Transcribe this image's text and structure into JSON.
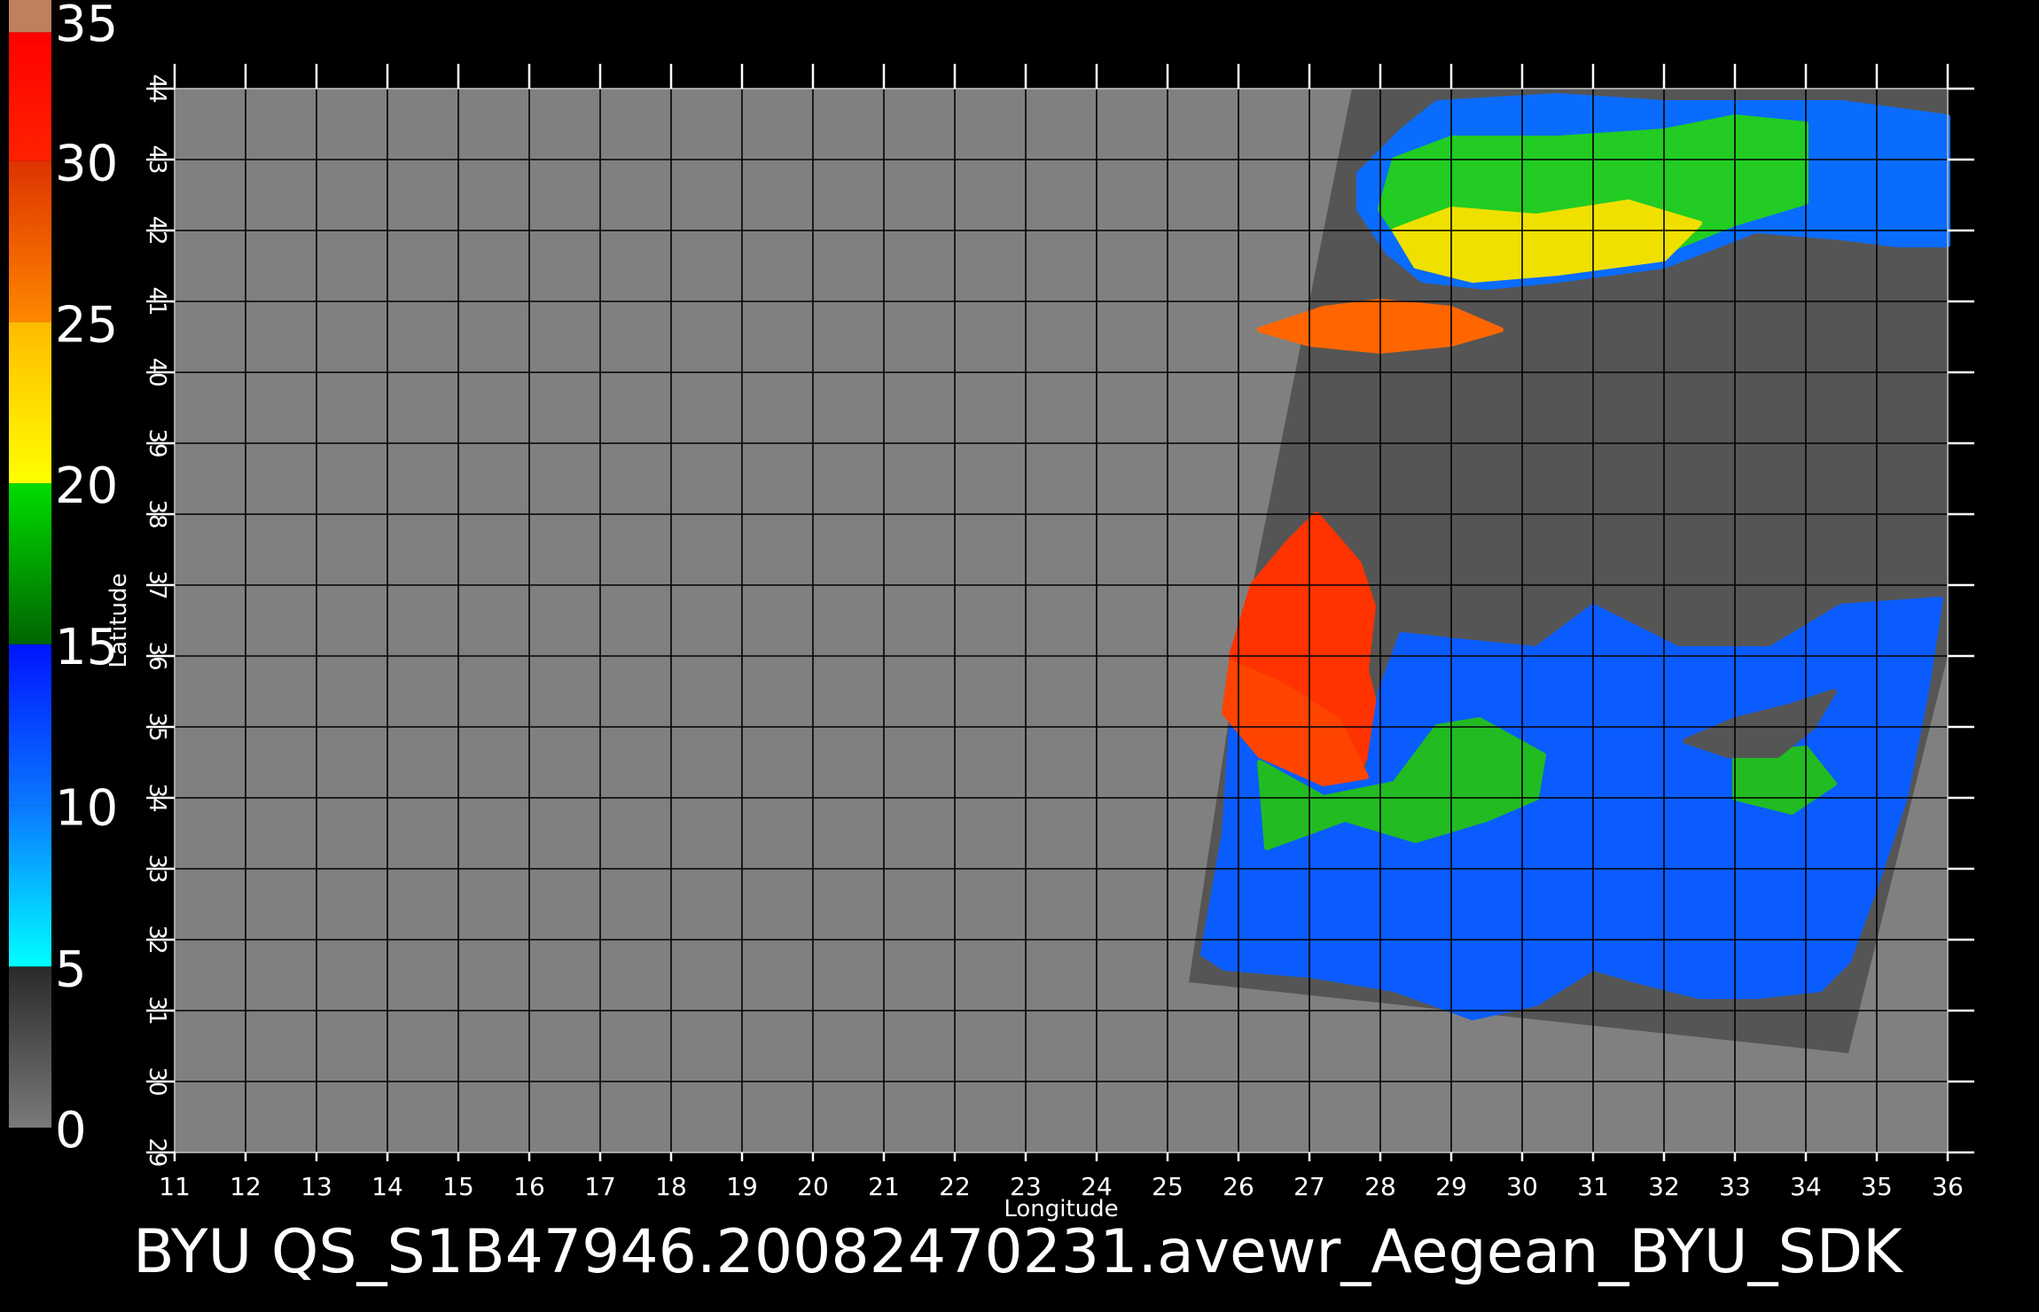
{
  "colorbar": {
    "tick_labels": [
      "0",
      "5",
      "10",
      "15",
      "20",
      "25",
      "30",
      "35"
    ],
    "segments": [
      {
        "from": 0,
        "to": 5,
        "color_bottom": "#7a7a7a",
        "color_top": "#2a2a2a"
      },
      {
        "from": 5,
        "to": 10,
        "color_bottom": "#00ffff",
        "color_top": "#0a78ff"
      },
      {
        "from": 10,
        "to": 15,
        "color_bottom": "#0a78ff",
        "color_top": "#0014ff"
      },
      {
        "from": 15,
        "to": 20,
        "color_bottom": "#006400",
        "color_top": "#00dd00"
      },
      {
        "from": 20,
        "to": 25,
        "color_bottom": "#ffff00",
        "color_top": "#ffbb00"
      },
      {
        "from": 25,
        "to": 30,
        "color_bottom": "#ff8800",
        "color_top": "#dd3300"
      },
      {
        "from": 30,
        "to": 34,
        "color_bottom": "#ff2200",
        "color_top": "#ff0000"
      },
      {
        "from": 34,
        "to": 35,
        "color_bottom": "#c08060",
        "color_top": "#c08060"
      }
    ]
  },
  "map": {
    "lon_range": [
      11,
      36
    ],
    "lat_range": [
      29,
      44
    ],
    "lon_ticks": [
      "11",
      "12",
      "13",
      "14",
      "15",
      "16",
      "17",
      "18",
      "19",
      "20",
      "21",
      "22",
      "23",
      "24",
      "25",
      "26",
      "27",
      "28",
      "29",
      "30",
      "31",
      "32",
      "33",
      "34",
      "35",
      "36"
    ],
    "lat_ticks": [
      "29",
      "30",
      "31",
      "32",
      "33",
      "34",
      "35",
      "36",
      "37",
      "38",
      "39",
      "40",
      "41",
      "42",
      "43",
      "44"
    ],
    "xlabel": "Longitude",
    "ylabel": "Latitude",
    "grid": true,
    "background_color": "#808080",
    "swath_color": "#555555",
    "swath_corners_lonlat": [
      [
        27.6,
        44.0
      ],
      [
        36.0,
        44.0
      ],
      [
        36.0,
        36.0
      ],
      [
        34.6,
        30.4
      ],
      [
        25.3,
        31.4
      ],
      [
        26.0,
        36.0
      ]
    ],
    "regions": [
      {
        "name": "black-sea-wind",
        "color": "#0a6cff",
        "polygon": [
          [
            27.7,
            42.8
          ],
          [
            28.3,
            43.4
          ],
          [
            28.8,
            43.8
          ],
          [
            30.5,
            43.9
          ],
          [
            32.0,
            43.8
          ],
          [
            34.5,
            43.8
          ],
          [
            36.0,
            43.6
          ],
          [
            36.0,
            41.8
          ],
          [
            35.3,
            41.8
          ],
          [
            34.5,
            41.9
          ],
          [
            33.3,
            42.0
          ],
          [
            32.0,
            41.5
          ],
          [
            30.5,
            41.3
          ],
          [
            29.5,
            41.2
          ],
          [
            28.6,
            41.3
          ],
          [
            28.1,
            41.7
          ],
          [
            27.7,
            42.3
          ]
        ]
      },
      {
        "name": "black-sea-moderate",
        "color": "#22cc22",
        "polygon": [
          [
            28.2,
            43.0
          ],
          [
            29.0,
            43.3
          ],
          [
            30.5,
            43.3
          ],
          [
            32.0,
            43.4
          ],
          [
            33.0,
            43.6
          ],
          [
            34.0,
            43.5
          ],
          [
            34.0,
            42.4
          ],
          [
            33.0,
            42.1
          ],
          [
            32.0,
            41.7
          ],
          [
            30.5,
            41.5
          ],
          [
            29.4,
            41.4
          ],
          [
            28.4,
            41.7
          ],
          [
            28.0,
            42.3
          ]
        ]
      },
      {
        "name": "black-sea-strong",
        "color": "#f0e000",
        "polygon": [
          [
            28.2,
            42.0
          ],
          [
            29.0,
            42.3
          ],
          [
            30.2,
            42.2
          ],
          [
            31.5,
            42.4
          ],
          [
            32.5,
            42.1
          ],
          [
            32.0,
            41.6
          ],
          [
            30.5,
            41.4
          ],
          [
            29.3,
            41.3
          ],
          [
            28.5,
            41.5
          ]
        ]
      },
      {
        "name": "marmara-wind",
        "color": "#ff6600",
        "polygon": [
          [
            26.3,
            40.6
          ],
          [
            27.2,
            40.9
          ],
          [
            28.0,
            41.0
          ],
          [
            29.0,
            40.9
          ],
          [
            29.7,
            40.6
          ],
          [
            29.0,
            40.4
          ],
          [
            28.0,
            40.3
          ],
          [
            27.0,
            40.4
          ]
        ]
      },
      {
        "name": "aegean-gale",
        "color": "#ff3300",
        "polygon": [
          [
            26.2,
            37.0
          ],
          [
            26.7,
            37.6
          ],
          [
            27.1,
            38.0
          ],
          [
            27.7,
            37.3
          ],
          [
            27.9,
            36.7
          ],
          [
            27.8,
            35.8
          ],
          [
            28.0,
            35.0
          ],
          [
            27.7,
            34.4
          ],
          [
            26.8,
            34.8
          ],
          [
            26.0,
            35.2
          ],
          [
            25.9,
            36.0
          ]
        ]
      },
      {
        "name": "levantine-basin-wind",
        "color": "#0a5cff",
        "polygon": [
          [
            25.9,
            35.0
          ],
          [
            26.8,
            34.8
          ],
          [
            27.8,
            34.2
          ],
          [
            28.0,
            35.5
          ],
          [
            28.3,
            36.3
          ],
          [
            29.2,
            36.2
          ],
          [
            30.2,
            36.1
          ],
          [
            31.0,
            36.7
          ],
          [
            32.2,
            36.1
          ],
          [
            33.5,
            36.1
          ],
          [
            34.5,
            36.7
          ],
          [
            35.9,
            36.8
          ],
          [
            35.7,
            35.5
          ],
          [
            35.4,
            34.0
          ],
          [
            35.0,
            32.8
          ],
          [
            34.6,
            31.7
          ],
          [
            34.2,
            31.3
          ],
          [
            33.3,
            31.2
          ],
          [
            32.5,
            31.2
          ],
          [
            31.7,
            31.4
          ],
          [
            31.0,
            31.6
          ],
          [
            30.2,
            31.1
          ],
          [
            29.3,
            30.9
          ],
          [
            28.2,
            31.3
          ],
          [
            27.0,
            31.5
          ],
          [
            25.8,
            31.6
          ],
          [
            25.5,
            31.8
          ],
          [
            25.8,
            33.5
          ]
        ]
      },
      {
        "name": "crete-area-gale",
        "color": "#ff4400",
        "polygon": [
          [
            25.9,
            35.9
          ],
          [
            26.6,
            35.6
          ],
          [
            27.4,
            35.1
          ],
          [
            27.8,
            34.3
          ],
          [
            27.2,
            34.2
          ],
          [
            26.3,
            34.6
          ],
          [
            25.8,
            35.2
          ]
        ]
      },
      {
        "name": "central-moderate-wind",
        "color": "#22bb22",
        "polygon": [
          [
            26.3,
            34.5
          ],
          [
            27.2,
            34.0
          ],
          [
            28.2,
            34.2
          ],
          [
            28.8,
            35.0
          ],
          [
            29.4,
            35.1
          ],
          [
            30.3,
            34.6
          ],
          [
            30.2,
            34.0
          ],
          [
            29.5,
            33.7
          ],
          [
            28.5,
            33.4
          ],
          [
            27.5,
            33.7
          ],
          [
            26.4,
            33.3
          ]
        ]
      },
      {
        "name": "east-moderate-wind",
        "color": "#22bb22",
        "polygon": [
          [
            33.0,
            34.6
          ],
          [
            34.0,
            34.7
          ],
          [
            34.4,
            34.2
          ],
          [
            33.8,
            33.8
          ],
          [
            33.0,
            34.0
          ]
        ]
      },
      {
        "name": "cyprus-landmask",
        "color": "#555555",
        "polygon": [
          [
            32.3,
            34.8
          ],
          [
            33.0,
            35.1
          ],
          [
            33.8,
            35.3
          ],
          [
            34.4,
            35.5
          ],
          [
            34.1,
            35.0
          ],
          [
            33.6,
            34.6
          ],
          [
            32.9,
            34.6
          ]
        ]
      }
    ]
  },
  "title_text": "BYU  QS_S1B47946.20082470231.avewr_Aegean_BYU_SDK"
}
